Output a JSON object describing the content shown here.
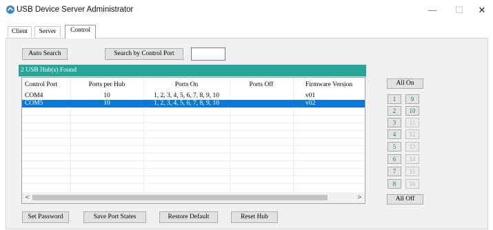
{
  "window": {
    "title": "USB Device Server Administrator",
    "controls": [
      "—",
      "☐",
      "✕"
    ]
  },
  "tabs": [
    {
      "label": "Client",
      "active": false
    },
    {
      "label": "Server",
      "active": false
    },
    {
      "label": "Control",
      "active": true
    }
  ],
  "toolbar": {
    "auto_search": "Auto Search",
    "search_by_port": "Search by Control Port",
    "port_input_value": ""
  },
  "status": "2 USB Hub(s) Found",
  "table": {
    "columns": [
      "Control Port",
      "Ports per Hub",
      "Ports On",
      "Ports Off",
      "Firmware Version"
    ],
    "rows": [
      {
        "control_port": "COM4",
        "ports_per_hub": "10",
        "ports_on": "1, 2, 3, 4, 5, 6, 7, 8, 9, 10",
        "ports_off": "",
        "firmware": "v01",
        "selected": false
      },
      {
        "control_port": "COM5",
        "ports_per_hub": "10",
        "ports_on": "1, 2, 3, 4, 5, 6, 7, 8, 9, 10",
        "ports_off": "",
        "firmware": "v02",
        "selected": true
      }
    ]
  },
  "ports": {
    "all_on": "All On",
    "all_off": "All Off",
    "buttons": [
      {
        "label": "1",
        "enabled": true
      },
      {
        "label": "9",
        "enabled": true
      },
      {
        "label": "2",
        "enabled": true
      },
      {
        "label": "10",
        "enabled": true
      },
      {
        "label": "3",
        "enabled": true
      },
      {
        "label": "11",
        "enabled": false
      },
      {
        "label": "4",
        "enabled": true
      },
      {
        "label": "12",
        "enabled": false
      },
      {
        "label": "5",
        "enabled": true
      },
      {
        "label": "13",
        "enabled": false
      },
      {
        "label": "6",
        "enabled": true
      },
      {
        "label": "14",
        "enabled": false
      },
      {
        "label": "7",
        "enabled": true
      },
      {
        "label": "15",
        "enabled": false
      },
      {
        "label": "8",
        "enabled": true
      },
      {
        "label": "16",
        "enabled": false
      }
    ]
  },
  "bottom": {
    "set_password": "Set Password",
    "save_port_states": "Save Port States",
    "restore_default": "Restore Default",
    "reset_hub": "Reset Hub"
  },
  "colors": {
    "status_bar": "#26a69a",
    "selection": "#0a78d7",
    "port_on_text": "#1a8a3c"
  }
}
